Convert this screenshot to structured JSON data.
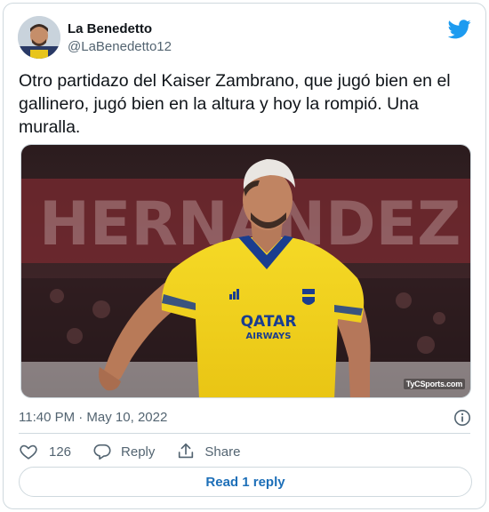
{
  "tweet": {
    "author": {
      "display_name": "La Benedetto",
      "handle": "@LaBenedetto12"
    },
    "text": "Otro partidazo del Kaiser Zambrano, que jugó bien en el gallinero, jugó bien en la altura y hoy la rompió. Una muralla.",
    "media": {
      "jersey_sponsor_line1": "QATAR",
      "jersey_sponsor_line2": "AIRWAYS",
      "banner_text": "HERNANDEZ",
      "watermark": "TyCSports.com"
    },
    "timestamp": "11:40 PM · May 10, 2022",
    "likes_count": "126",
    "reply_label": "Reply",
    "share_label": "Share",
    "read_replies_label": "Read 1 reply"
  },
  "colors": {
    "twitter_blue": "#1d9bf0",
    "link_blue": "#1d6fb8",
    "text_primary": "#0f1419",
    "text_secondary": "#536471",
    "border": "#cfd9de",
    "jersey_yellow": "#f2d21b",
    "jersey_blue": "#1a3d8f"
  },
  "icons": [
    "twitter-bird-icon",
    "info-icon",
    "heart-icon",
    "reply-bubble-icon",
    "share-icon"
  ]
}
